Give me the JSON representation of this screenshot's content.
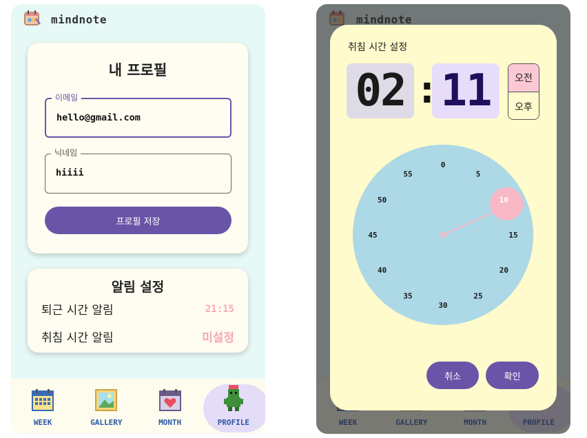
{
  "app": {
    "title": "mindnote"
  },
  "profile": {
    "title": "내 프로필",
    "email_label": "이메일",
    "email_value": "hello@gmail.com",
    "nickname_label": "닉네임",
    "nickname_value": "hiiii",
    "save_label": "프로필 저장"
  },
  "alarm": {
    "title": "알림 설정",
    "rows": [
      {
        "label": "퇴근 시간 알림",
        "value": "21:15"
      },
      {
        "label": "취침 시간 알림",
        "value": "미설정"
      }
    ]
  },
  "nav": {
    "items": [
      {
        "label": "WEEK",
        "icon": "calendar-week-icon"
      },
      {
        "label": "GALLERY",
        "icon": "gallery-picture-icon"
      },
      {
        "label": "MONTH",
        "icon": "calendar-heart-icon"
      },
      {
        "label": "PROFILE",
        "icon": "pixel-character-icon",
        "active": true
      }
    ]
  },
  "time_dialog": {
    "title": "취침 시간 설정",
    "hour": "02",
    "separator": ":",
    "minute": "11",
    "am_label": "오전",
    "pm_label": "오후",
    "selected_period": "오전",
    "dial_labels": [
      "0",
      "5",
      "10",
      "15",
      "20",
      "25",
      "30",
      "35",
      "40",
      "45",
      "50",
      "55"
    ],
    "selected_dial_label": "10",
    "hand_minute": 11,
    "cancel_label": "취소",
    "ok_label": "확인"
  },
  "colors": {
    "primary": "#6a54a8",
    "background": "#e6f9f6",
    "card": "#fffdf1",
    "accent_pink": "#f7a8b8",
    "dialog": "#fffbcc",
    "dial": "#add8e6",
    "nav_text": "#2a58a8"
  }
}
